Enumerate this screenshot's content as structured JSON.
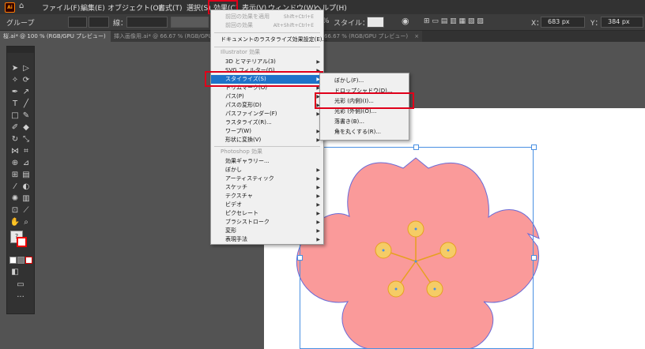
{
  "menubar": {
    "items": [
      "ファイル(F)",
      "編集(E)",
      "オブジェクト(O)",
      "書式(T)",
      "選択(S)",
      "効果(C)",
      "表示(V)",
      "ウィンドウ(W)",
      "ヘルプ(H)"
    ],
    "app_icon": "Ai"
  },
  "controlbar": {
    "group_label": "グループ",
    "stroke_label": "線：",
    "percent_label": "%",
    "style_label": "スタイル：",
    "x_label": "X：",
    "x_value": "683 px",
    "y_label": "Y：",
    "y_value": "384 px"
  },
  "tabs": [
    {
      "label": "桜.ai* @ 100 % (RGB/GPU プレビュー)",
      "close": "×"
    },
    {
      "label": "挿入画像用.ai* @ 66.67 % (RGB/GPU プレビュー)",
      "close": "×"
    },
    {
      "label": "66.67 % (RGB/GPU プレビュー)",
      "close": "×"
    }
  ],
  "effect_menu": {
    "items": [
      {
        "label": "前回の効果を適用",
        "shortcut": "Shift+Ctrl+E",
        "state": "disabled"
      },
      {
        "label": "前回の効果",
        "shortcut": "Alt+Shift+Ctrl+E",
        "state": "disabled"
      },
      {
        "label": "ドキュメントのラスタライズ効果設定(E)...",
        "state": "normal"
      },
      {
        "label": "Illustrator 効果",
        "state": "header"
      },
      {
        "label": "3D とマテリアル(3)",
        "state": "normal",
        "submenu": true
      },
      {
        "label": "SVG フィルター(G)",
        "state": "normal",
        "submenu": true
      },
      {
        "label": "スタイライズ(S)",
        "state": "highlighted",
        "submenu": true
      },
      {
        "label": "トリムマーク(O)",
        "state": "normal",
        "submenu": true
      },
      {
        "label": "パス(P)",
        "state": "normal",
        "submenu": true
      },
      {
        "label": "パスの変形(D)",
        "state": "normal",
        "submenu": true
      },
      {
        "label": "パスファインダー(F)",
        "state": "normal",
        "submenu": true
      },
      {
        "label": "ラスタライズ(R)...",
        "state": "normal"
      },
      {
        "label": "ワープ(W)",
        "state": "normal",
        "submenu": true
      },
      {
        "label": "形状に変換(V)",
        "state": "normal",
        "submenu": true
      },
      {
        "label": "Photoshop 効果",
        "state": "header"
      },
      {
        "label": "効果ギャラリー...",
        "state": "normal"
      },
      {
        "label": "ぼかし",
        "state": "normal",
        "submenu": true
      },
      {
        "label": "アーティスティック",
        "state": "normal",
        "submenu": true
      },
      {
        "label": "スケッチ",
        "state": "normal",
        "submenu": true
      },
      {
        "label": "テクスチャ",
        "state": "normal",
        "submenu": true
      },
      {
        "label": "ビデオ",
        "state": "normal",
        "submenu": true
      },
      {
        "label": "ピクセレート",
        "state": "normal",
        "submenu": true
      },
      {
        "label": "ブラシストローク",
        "state": "normal",
        "submenu": true
      },
      {
        "label": "変形",
        "state": "normal",
        "submenu": true
      },
      {
        "label": "表現手法",
        "state": "normal",
        "submenu": true
      }
    ]
  },
  "stylize_submenu": {
    "items": [
      {
        "label": "ぼかし(F)...",
        "state": "normal"
      },
      {
        "label": "ドロップシャドウ(D)...",
        "state": "normal"
      },
      {
        "label": "光彩 (内側)(I)...",
        "state": "focused"
      },
      {
        "label": "光彩 (外側)(O)...",
        "state": "normal"
      },
      {
        "label": "落書き(B)...",
        "state": "normal"
      },
      {
        "label": "角を丸くする(R)...",
        "state": "normal"
      }
    ]
  },
  "colors": {
    "petal": "#fa9a9a",
    "petal_stroke": "#6a6ad6",
    "stamen": "#f5cc66",
    "stamen_stroke": "#e6a020",
    "highlight_box": "#e0001a",
    "menu_highlight": "#1e73c9"
  },
  "icons": [
    "home-icon",
    "selection-tool-icon",
    "direct-selection-icon",
    "pen-icon",
    "type-icon",
    "line-icon",
    "rectangle-icon",
    "brush-icon",
    "pencil-icon",
    "eraser-icon",
    "rotate-icon",
    "scale-icon",
    "width-icon",
    "free-transform-icon",
    "shape-builder-icon",
    "perspective-icon",
    "mesh-icon",
    "gradient-icon",
    "eyedropper-icon",
    "blend-icon",
    "symbol-sprayer-icon",
    "graph-icon",
    "artboard-icon",
    "slice-icon",
    "hand-icon",
    "zoom-icon"
  ]
}
